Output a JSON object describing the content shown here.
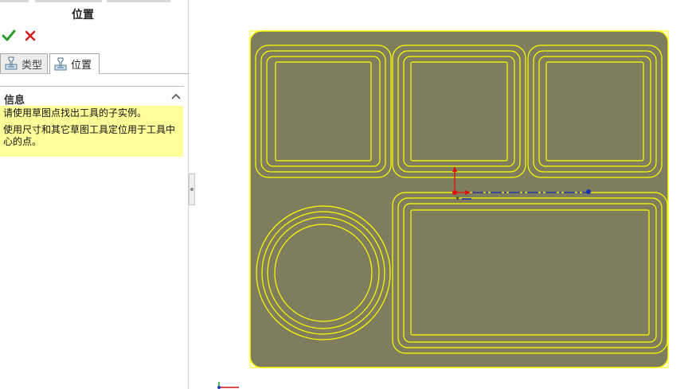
{
  "property_manager": {
    "title": "位置",
    "ok_icon": "checkmark-icon",
    "cancel_icon": "cross-icon",
    "tabs": [
      {
        "label": "类型",
        "icon": "hole-wizard-icon",
        "active": false
      },
      {
        "label": "位置",
        "icon": "hole-wizard-icon",
        "active": true
      }
    ],
    "info_section": {
      "title": "信息",
      "messages": [
        "请使用草图点找出工具的子实例。",
        "使用尺寸和其它草图工具定位用于工具中心的点。"
      ]
    }
  },
  "viewport": {
    "face_color": "#7e7e5e",
    "edge_color": "#ffff00",
    "origin_indicator": "origin-axes-icon",
    "triad_icon": "view-triad-icon"
  },
  "colors": {
    "info_background": "#ffff99",
    "ok_green": "#2e9a2e",
    "cancel_red": "#d42020"
  }
}
